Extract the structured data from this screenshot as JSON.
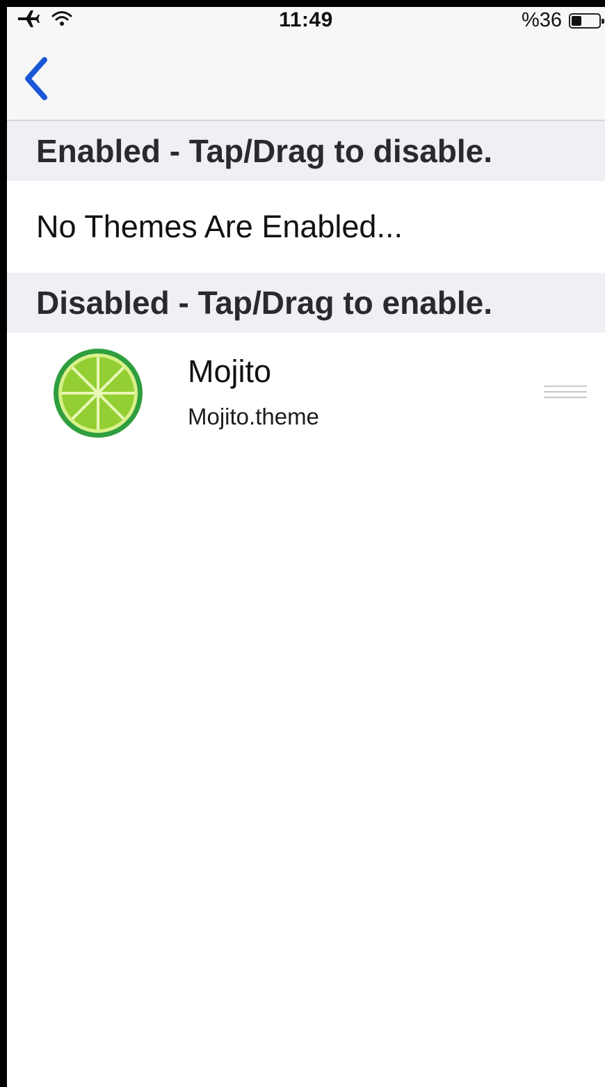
{
  "status_bar": {
    "time": "11:49",
    "battery_text": "%36",
    "battery_level": 0.36,
    "icons": [
      "airplane-icon",
      "wifi-icon",
      "battery-icon"
    ]
  },
  "nav": {
    "back_icon": "chevron-left-icon",
    "accent_color": "#1a57d6"
  },
  "sections": {
    "enabled_header": "Enabled - Tap/Drag to disable.",
    "enabled_empty": "No Themes Are Enabled...",
    "disabled_header": "Disabled - Tap/Drag to enable."
  },
  "themes": [
    {
      "name": "Mojito",
      "file": "Mojito.theme",
      "icon": "lime-icon",
      "handle_icon": "drag-handle-icon"
    }
  ]
}
